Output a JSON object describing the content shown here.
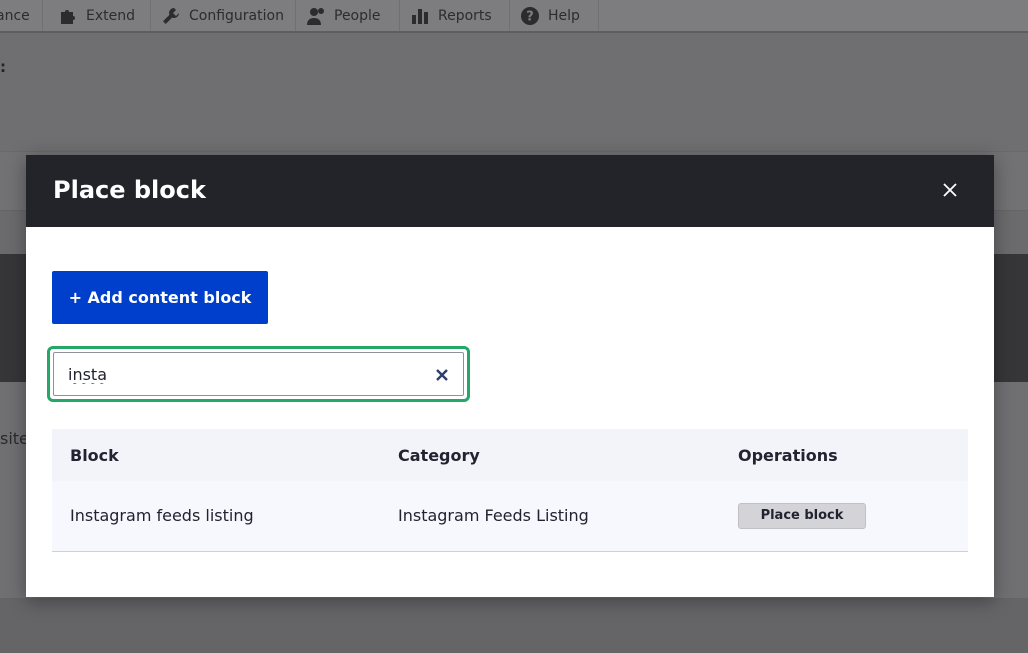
{
  "toolbar": {
    "tabs": [
      {
        "label": "ance",
        "icon": "appearance-icon"
      },
      {
        "label": "Extend",
        "icon": "puzzle-icon"
      },
      {
        "label": "Configuration",
        "icon": "wrench-icon"
      },
      {
        "label": "People",
        "icon": "people-icon"
      },
      {
        "label": "Reports",
        "icon": "bar-chart-icon"
      },
      {
        "label": "Help",
        "icon": "help-icon"
      }
    ]
  },
  "background": {
    "colon": ":",
    "site_fragment": "site"
  },
  "dialog": {
    "title": "Place block",
    "close_icon": "close-icon",
    "add_button_label": "+ Add content block",
    "search": {
      "value": "insta",
      "placeholder": ""
    },
    "table": {
      "headers": [
        "Block",
        "Category",
        "Operations"
      ],
      "rows": [
        {
          "block": "Instagram feeds listing",
          "category": "Instagram Feeds Listing",
          "operation": "Place block"
        }
      ]
    }
  },
  "colors": {
    "header_bg": "#232429",
    "primary_button": "#003ecc",
    "focus_ring": "#26a769"
  }
}
